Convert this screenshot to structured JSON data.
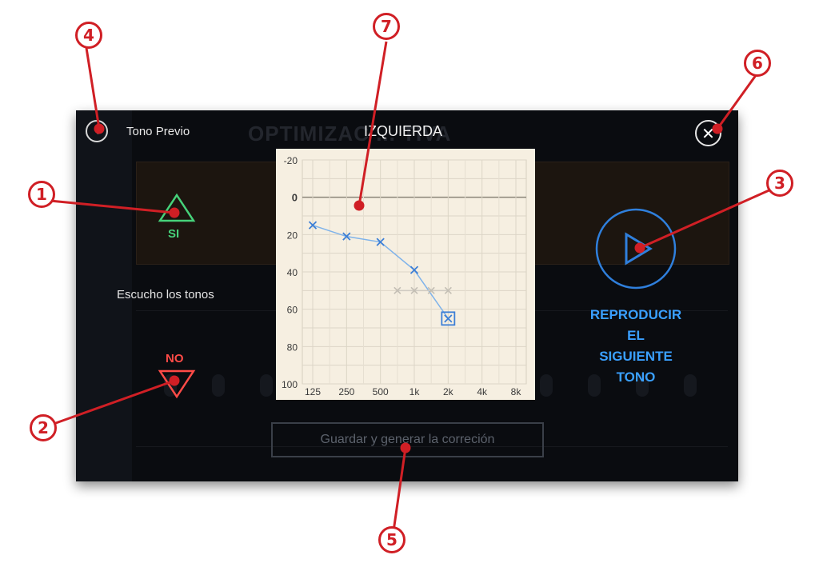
{
  "window": {
    "back_label": "Tono Previo",
    "ear_title": "IZQUIERDA",
    "background_title": "OPTIMIZAC ... TIVA"
  },
  "responses": {
    "yes_label": "SI",
    "hear_label": "Escucho los tonos",
    "no_label": "NO"
  },
  "play": {
    "label_lines": [
      "REPRODUCIR",
      "EL",
      "SIGUIENTE",
      "TONO"
    ]
  },
  "save": {
    "label": "Guardar y generar la correción"
  },
  "chart_data": {
    "type": "line",
    "categories": [
      "125",
      "250",
      "500",
      "1k",
      "2k",
      "4k",
      "8k"
    ],
    "y_ticks": [
      "-20",
      "0",
      "20",
      "40",
      "60",
      "80",
      "100"
    ],
    "ylim": [
      -20,
      100
    ],
    "y_inverted": true,
    "grid": true,
    "series": [
      {
        "values": [
          15,
          21,
          24,
          39,
          65
        ]
      },
      {
        "values": [
          null,
          null,
          null,
          null,
          50,
          50,
          50
        ],
        "partial_x": [
          2.5,
          3,
          3.5,
          4
        ]
      }
    ],
    "selected_point": {
      "category": "2k",
      "value": 65
    }
  },
  "annotations": [
    "1",
    "2",
    "3",
    "4",
    "5",
    "6",
    "7"
  ],
  "colors": {
    "yes": "#46d27a",
    "no": "#ff4b47",
    "play": "#3aa0ff",
    "callout": "#d01f25",
    "chart_line": "#7fb3ea",
    "chart_marker": "#3d7fd6"
  }
}
